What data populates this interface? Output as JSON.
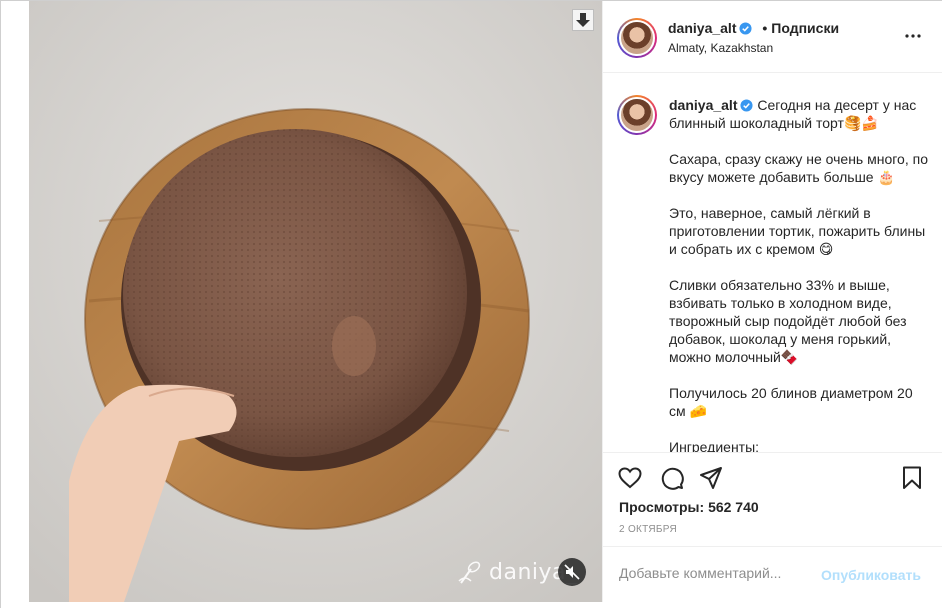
{
  "post": {
    "username": "daniya_alt",
    "follow_state": "Подписки",
    "separator": "•",
    "location": "Almaty, Kazakhstan",
    "caption_username": "daniya_alt",
    "caption": "Сегодня на десерт у нас блинный шоколадный торт🥞🍰\n\nСахара, сразу скажу не очень много, по вкусу можете добавить больше 🎂\n\nЭто, наверное, самый лёгкий в приготовлении тортик, пожарить блины и собрать их с кремом 😋\n\nСливки обязательно 33% и выше, взбивать только в холодном виде, творожный сыр подойдёт любой без добавок, шоколад у меня горький, можно молочный🍫\n\nПолучилось 20 блинов диаметром 20 см 🧀\n\nИнгредиенты:",
    "views_label": "Просмотры:",
    "views_count": "562 740",
    "date": "2 октября"
  },
  "media": {
    "watermark": "daniya_"
  },
  "comment": {
    "placeholder": "Добавьте комментарий...",
    "publish_label": "Опубликовать"
  },
  "icons": {
    "more": "more-horizontal-icon",
    "like": "heart-icon",
    "comment": "comment-icon",
    "share": "share-icon",
    "save": "bookmark-icon",
    "mute": "muted-speaker-icon",
    "download": "download-arrow-icon",
    "verified": "verified-badge-icon"
  },
  "colors": {
    "verified": "#3897f0",
    "publish_disabled": "#b2dffc",
    "secondary_text": "#8e8e8e"
  }
}
